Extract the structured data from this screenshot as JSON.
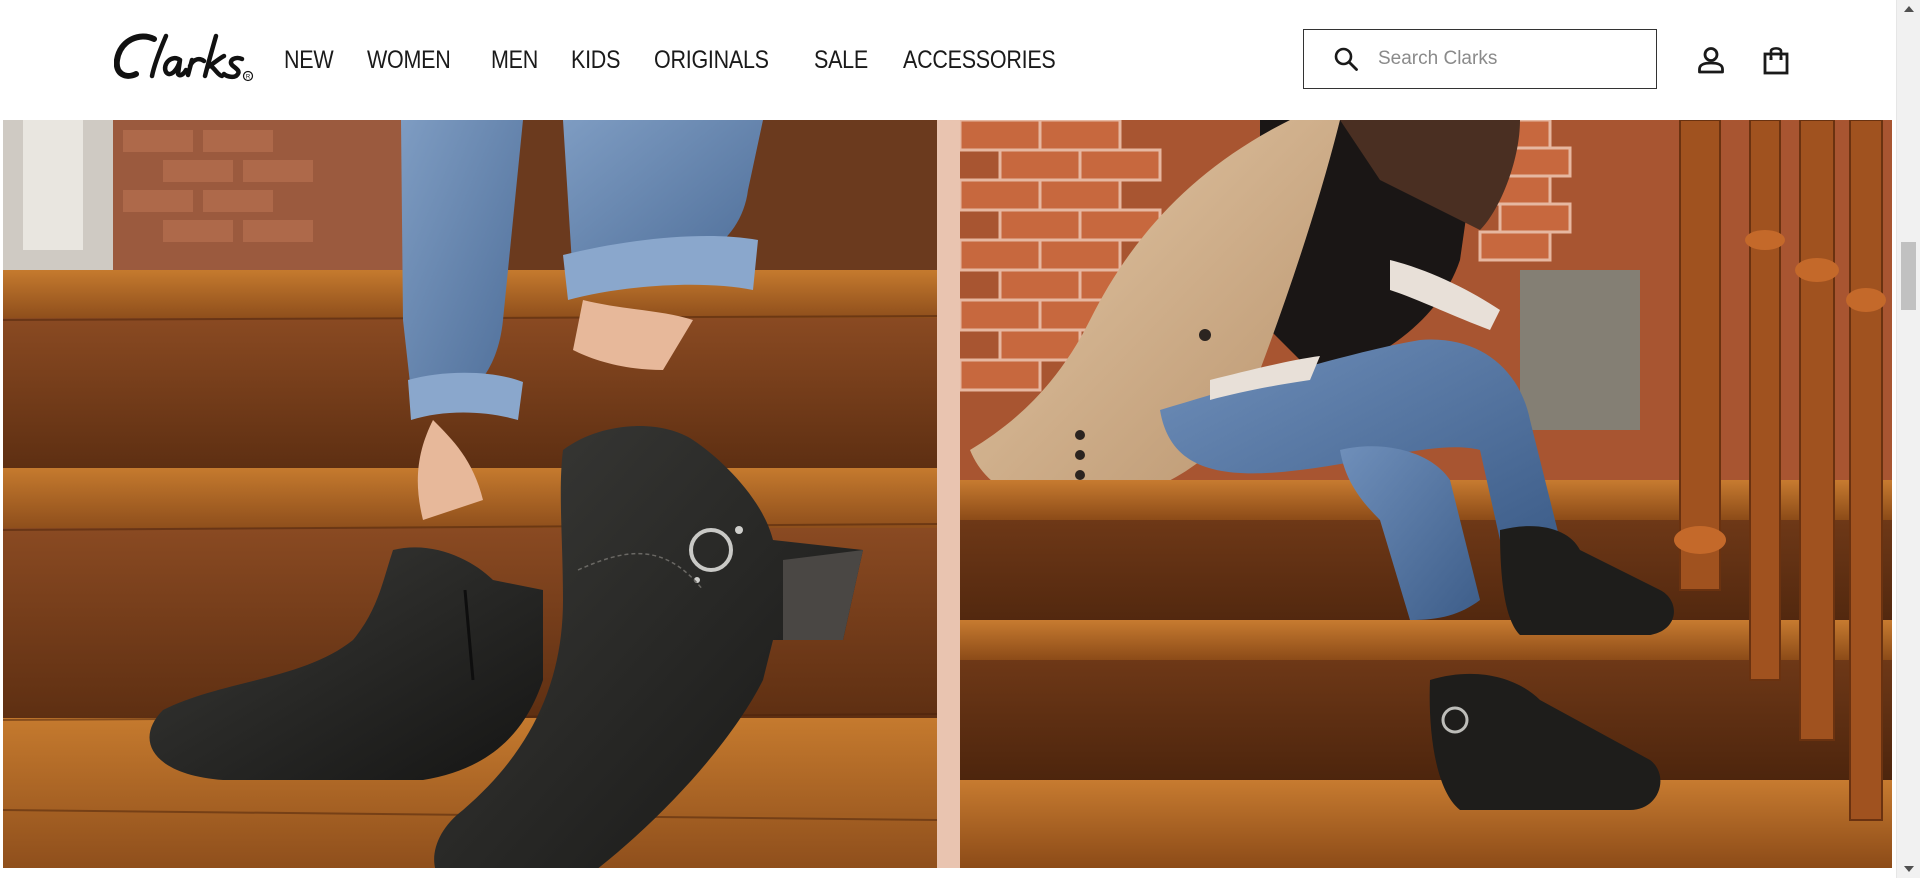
{
  "header": {
    "brand": "Clarks",
    "nav": [
      {
        "label": "NEW"
      },
      {
        "label": "WOMEN"
      },
      {
        "label": "MEN"
      },
      {
        "label": "KIDS"
      },
      {
        "label": "ORIGINALS"
      },
      {
        "label": "SALE"
      },
      {
        "label": "ACCESSORIES"
      }
    ],
    "search": {
      "placeholder": "Search Clarks",
      "value": ""
    },
    "icons": {
      "search": "search-icon",
      "account": "account-icon",
      "bag": "shopping-bag-icon"
    }
  },
  "hero": {
    "left_image": "Close-up of black leather ankle boots with buckle strap on wooden stairs, blue cuffed jeans",
    "right_image": "Woman in ripped jeans and beige blazer sitting on wooden stairs wearing black ankle boots",
    "divider_color": "#e9c4b0"
  },
  "colors": {
    "text": "#1a1a1a",
    "search_border": "#333333",
    "placeholder": "#8a8a8a"
  }
}
